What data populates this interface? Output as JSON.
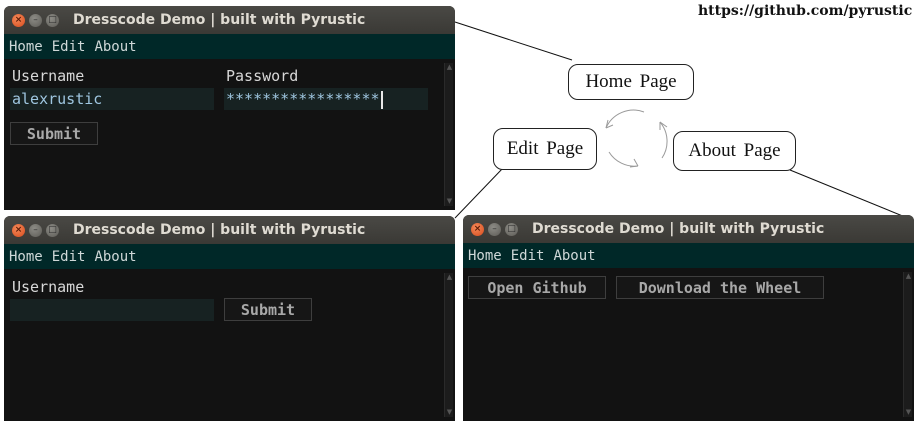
{
  "url_text": "https://github.com/pyrustic",
  "window_title": "Dresscode Demo | built with Pyrustic",
  "titlebar_buttons": {
    "close": "×",
    "minimize": "–",
    "maximize": "□"
  },
  "menu": [
    "Home",
    "Edit",
    "About"
  ],
  "home_window": {
    "username_label": "Username",
    "password_label": "Password",
    "username_value": "alexrustic",
    "password_value": "*****************",
    "submit_label": "Submit"
  },
  "edit_window": {
    "username_label": "Username",
    "username_value": "",
    "submit_label": "Submit"
  },
  "about_window": {
    "github_button": "Open Github",
    "wheel_button": "Download the Wheel"
  },
  "diagram": {
    "home_bubble": "Home Page",
    "edit_bubble": "Edit Page",
    "about_bubble": "About Page"
  },
  "icons": {
    "cycle": "cycle-arrows-icon"
  },
  "colors": {
    "menubar": "#002828",
    "window_bg": "#121212",
    "close_button": "#e05a2a"
  }
}
